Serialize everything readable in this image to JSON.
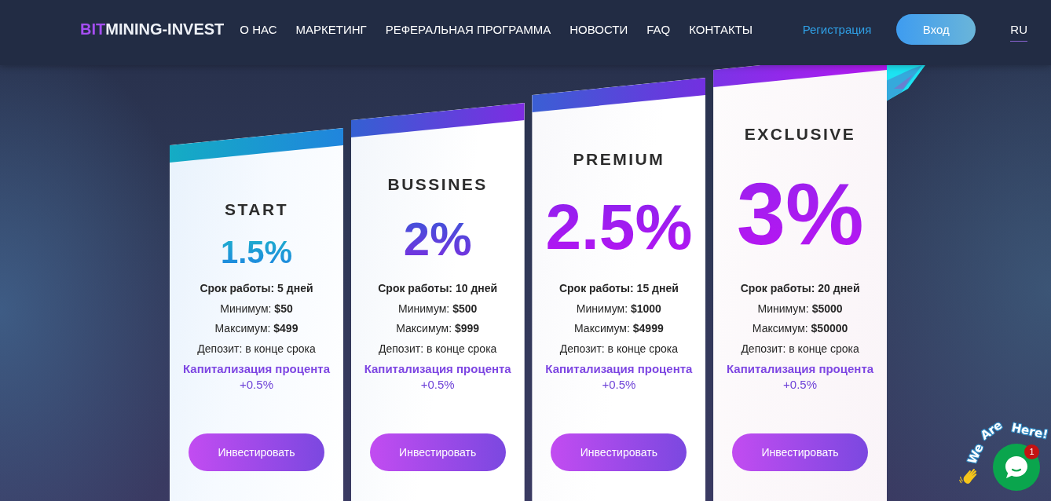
{
  "header": {
    "logo": {
      "accent": "BIT",
      "rest": "MINING-INVEST"
    },
    "nav": [
      "О НАС",
      "МАРКЕТИНГ",
      "РЕФЕРАЛЬНАЯ ПРОГРАММА",
      "НОВОСТИ",
      "FAQ",
      "КОНТАКТЫ"
    ],
    "register_link": "Регистрация",
    "login_button": "Вход",
    "language": {
      "label": "RU",
      "selected": true
    }
  },
  "plans": [
    {
      "name": "START",
      "rate": "1.5%",
      "term": "Срок работы: 5 дней",
      "minimum": "Минимум: **$50**",
      "maximum": "Максимум: **$499**",
      "deposit": "Депозит: в конце срока",
      "capitalization": "Капитализация процента",
      "capitalization_rate": "+0.5%",
      "button": "Инвестировать"
    },
    {
      "name": "BUSSINES",
      "rate": "2%",
      "term": "Срок работы: 10 дней",
      "minimum": "Минимум: **$500**",
      "maximum": "Максимум: **$999**",
      "deposit": "Депозит: в конце срока",
      "capitalization": "Капитализация процента",
      "capitalization_rate": "+0.5%",
      "button": "Инвестировать"
    },
    {
      "name": "PREMIUM",
      "rate": "2.5%",
      "term": "Срок работы: 15 дней",
      "minimum": "Минимум: **$1000**",
      "maximum": "Максимум: **$4999**",
      "deposit": "Депозит: в конце срока",
      "capitalization": "Капитализация процента",
      "capitalization_rate": "+0.5%",
      "button": "Инвестировать"
    },
    {
      "name": "EXCLUSIVE",
      "rate": "3%",
      "term": "Срок работы: 20 дней",
      "minimum": "Минимум: **$5000**",
      "maximum": "Максимум: **$50000**",
      "deposit": "Депозит: в конце срока",
      "capitalization": "Капитализация процента",
      "capitalization_rate": "+0.5%",
      "button": "Инвестировать"
    }
  ],
  "chat_widget": {
    "greeting_words": [
      "We",
      "Are",
      "Here!"
    ],
    "badge": "1"
  }
}
